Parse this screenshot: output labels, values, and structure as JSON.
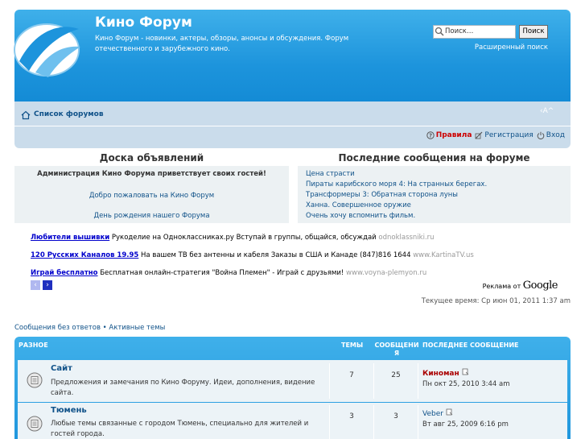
{
  "header": {
    "title": "Кино Форум",
    "description": "Кино Форум - новинки, актеры, обзоры, анонсы и обсуждения. Форум отечественного и зарубежного кино.",
    "search_placeholder": "Поиск…",
    "search_button": "Поиск",
    "advanced_search": "Расширенный поиск"
  },
  "navbar": {
    "forum_list": "Список форумов",
    "font_size": "‹A^",
    "links": [
      {
        "label": "Правила",
        "icon": "question-icon"
      },
      {
        "label": "Регистрация",
        "icon": "register-icon"
      },
      {
        "label": "Вход",
        "icon": "power-icon"
      }
    ]
  },
  "announcements": {
    "title": "Доска объявлений",
    "lines": [
      "Администрация Кино Форума приветствует своих гостей!",
      "Добро пожаловать на Кино Форум",
      "День рождения нашего Форума"
    ]
  },
  "latest": {
    "title": "Последние сообщения на форуме",
    "items": [
      "Цена страсти",
      "Пираты карибского моря 4: На странных берегах.",
      "Трансформеры 3: Обратная сторона луны",
      "Ханна. Совершенное оружие",
      "Очень хочу вспомнить фильм."
    ]
  },
  "ads": [
    {
      "link": "Любители вышивки",
      "text": " Рукоделие на Одноклассниках.ру Вступай в группы, общайся, обсуждай ",
      "url": "odnoklassniki.ru"
    },
    {
      "link": "120 Русских Каналов 19.95",
      "text": " На вашем ТВ без антенны и кабеля Заказы в США и Канаде (847)816 1644 ",
      "url": "www.KartinaTV.us"
    },
    {
      "link": "Играй бесплатно",
      "text": " Бесплатная онлайн-стратегия \"Война Племен\" - Играй с друзьями! ",
      "url": "www.voyna-plemyon.ru"
    }
  ],
  "ads_by": {
    "prefix": "Реклама от ",
    "brand": "Google"
  },
  "current_time": "Текущее время: Ср июн 01, 2011 1:37 am",
  "quick_links": "Сообщения без ответов • Активные темы",
  "table": {
    "category": "Разное",
    "col_topics": "Темы",
    "col_posts": "Сообщения",
    "col_last": "Последнее сообщение",
    "rows": [
      {
        "name": "Сайт",
        "description": "Предложения и замечания по Кино Форуму. Идеи, дополнения, видение сайта.",
        "topics": "7",
        "posts": "25",
        "last_user": "Киноман",
        "last_user_color": "#aa0000",
        "last_date": "Пн окт 25, 2010 3:44 am"
      },
      {
        "name": "Тюмень",
        "description": "Любые темы связанные с городом Тюмень, специально для жителей и гостей города.",
        "topics": "3",
        "posts": "3",
        "last_user": "Veber",
        "last_user_color": "#105289",
        "last_date": "Вт авг 25, 2009 6:16 pm"
      }
    ]
  }
}
